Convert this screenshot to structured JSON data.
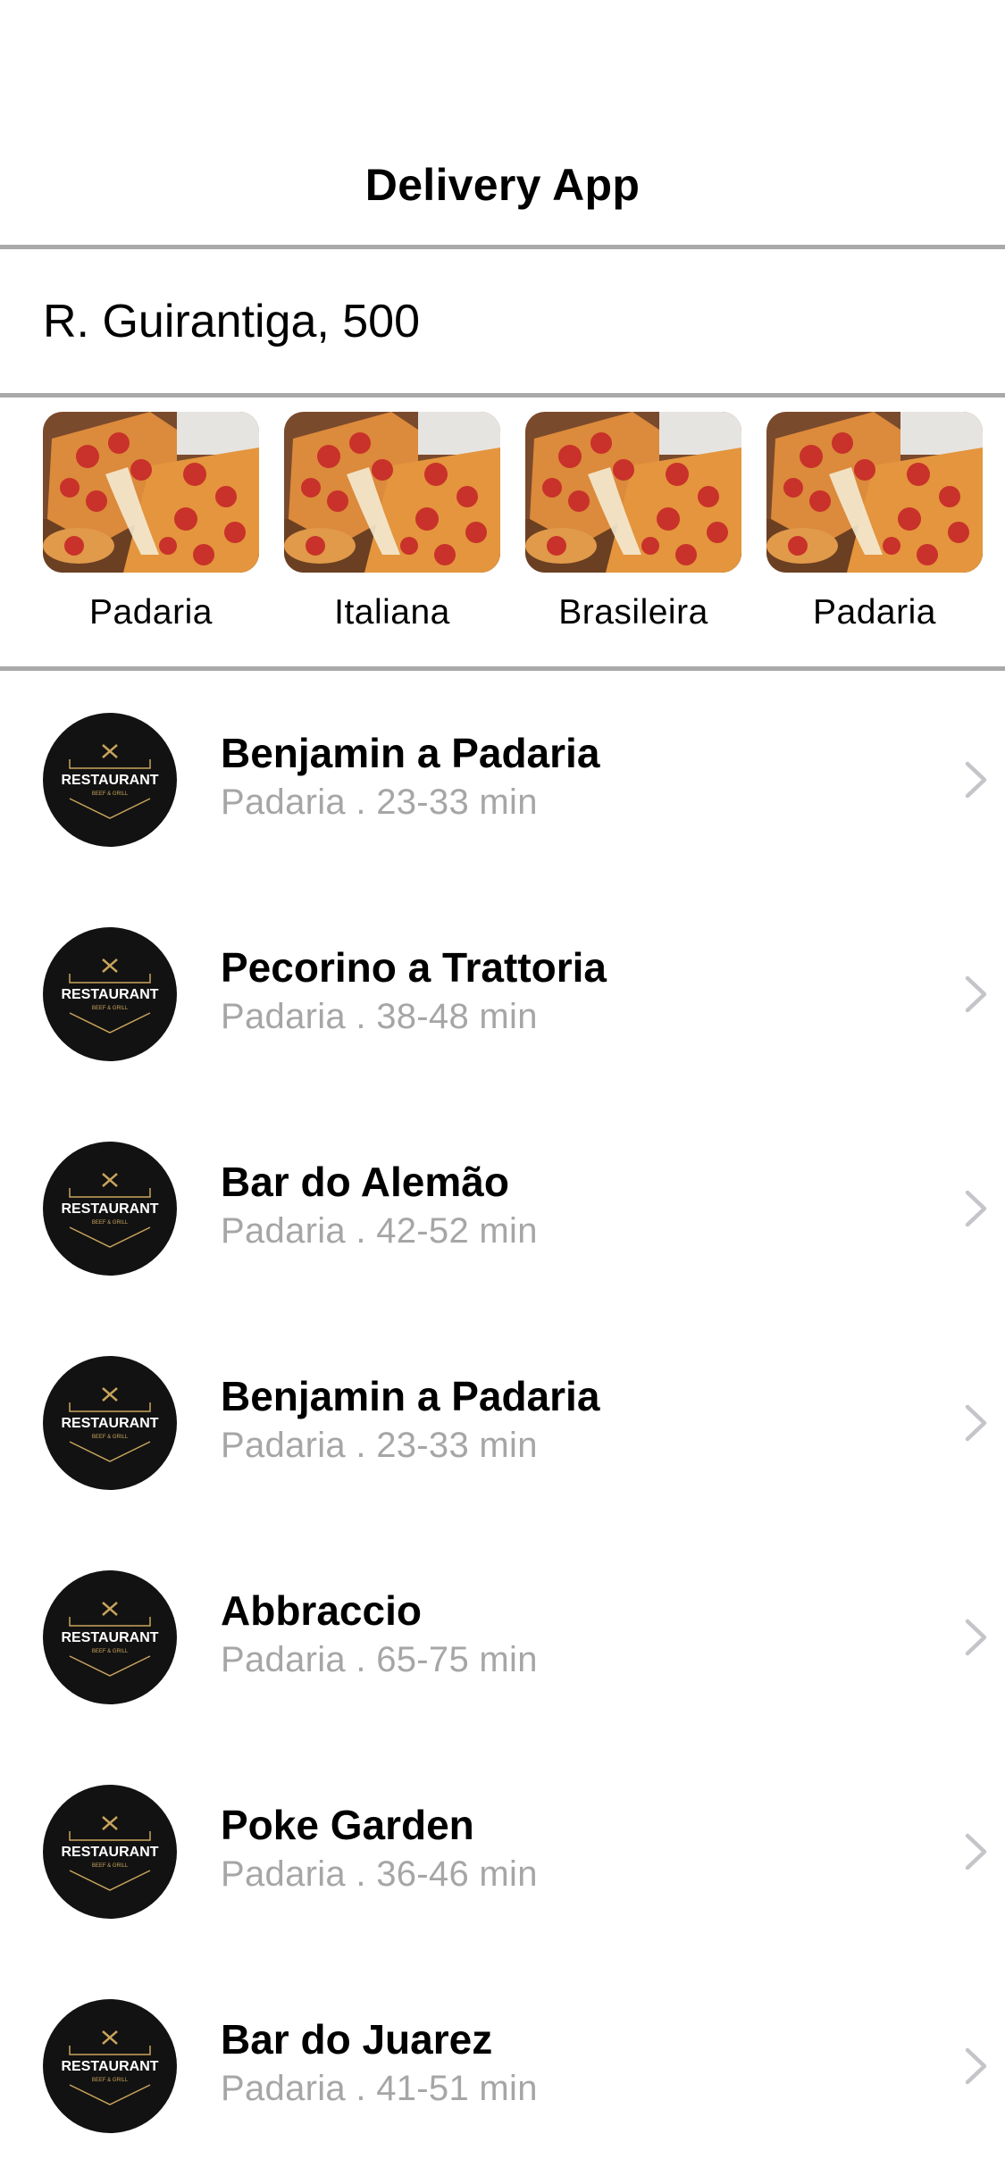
{
  "header": {
    "title": "Delivery App"
  },
  "address": {
    "text": "R. Guirantiga, 500"
  },
  "categories": [
    {
      "label": "Padaria",
      "image": "pizza-photo"
    },
    {
      "label": "Italiana",
      "image": "pizza-photo"
    },
    {
      "label": "Brasileira",
      "image": "pizza-photo"
    },
    {
      "label": "Padaria",
      "image": "pizza-photo"
    }
  ],
  "restaurant_logo": {
    "text": "RESTAURANT",
    "subtext": "BEEF & GRILL",
    "icon": "crossed-fork-knife-icon"
  },
  "restaurants": [
    {
      "name": "Benjamin a Padaria",
      "subtitle": "Padaria . 23-33 min"
    },
    {
      "name": "Pecorino a Trattoria",
      "subtitle": "Padaria . 38-48 min"
    },
    {
      "name": "Bar do Alemão",
      "subtitle": "Padaria . 42-52 min"
    },
    {
      "name": "Benjamin a Padaria",
      "subtitle": "Padaria . 23-33 min"
    },
    {
      "name": "Abbraccio",
      "subtitle": "Padaria . 65-75 min"
    },
    {
      "name": "Poke Garden",
      "subtitle": "Padaria . 36-46 min"
    },
    {
      "name": "Bar do Juarez",
      "subtitle": "Padaria . 41-51 min"
    }
  ],
  "colors": {
    "divider": "#a9a9a9",
    "subtitle": "#a6a6a6",
    "logo_bg": "#121212",
    "logo_gold": "#c9a45c",
    "chevron": "#c4c4c9"
  }
}
